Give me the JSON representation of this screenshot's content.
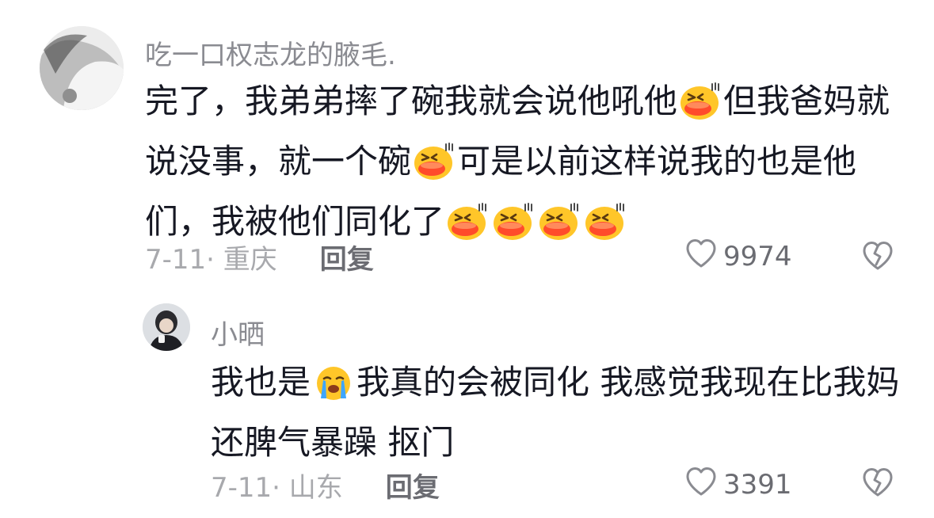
{
  "comments": [
    {
      "username": "吃一口权志龙的腋毛.",
      "avatar_icon": "profile-photo-avatar",
      "text_segments": [
        {
          "t": "完了，我弟弟摔了碗我就会说他吼他"
        },
        {
          "emoji": "laughing-face-icon"
        },
        {
          "t": "但我爸妈就说没事，就一个碗"
        },
        {
          "emoji": "laughing-face-icon"
        },
        {
          "t": "可是以前这样说我的也是他们，我被他们同化了"
        },
        {
          "emoji": "laughing-face-icon"
        },
        {
          "emoji": "laughing-face-icon"
        },
        {
          "emoji": "laughing-face-icon"
        },
        {
          "emoji": "laughing-face-icon"
        }
      ],
      "date": "7-11",
      "location": "重庆",
      "date_location": "7-11· 重庆",
      "reply_label": "回复",
      "like_count": "9974"
    },
    {
      "username": "小晒",
      "avatar_icon": "profile-photo-avatar",
      "text_segments": [
        {
          "t": "我也是"
        },
        {
          "emoji": "crying-face-icon"
        },
        {
          "t": "我真的会被同化 我感觉我现在比我妈还脾气暴躁 抠门"
        }
      ],
      "date": "7-11",
      "location": "山东",
      "date_location": "7-11· 山东",
      "reply_label": "回复",
      "like_count": "3391"
    }
  ],
  "icons": {
    "like": "heart-outline-icon",
    "dislike": "broken-heart-icon"
  },
  "colors": {
    "username": "#8a8b91",
    "text": "#161823",
    "meta": "#a8a9ad",
    "emoji_face": "#ffc629",
    "emoji_mouth": "#ff4b2b"
  }
}
